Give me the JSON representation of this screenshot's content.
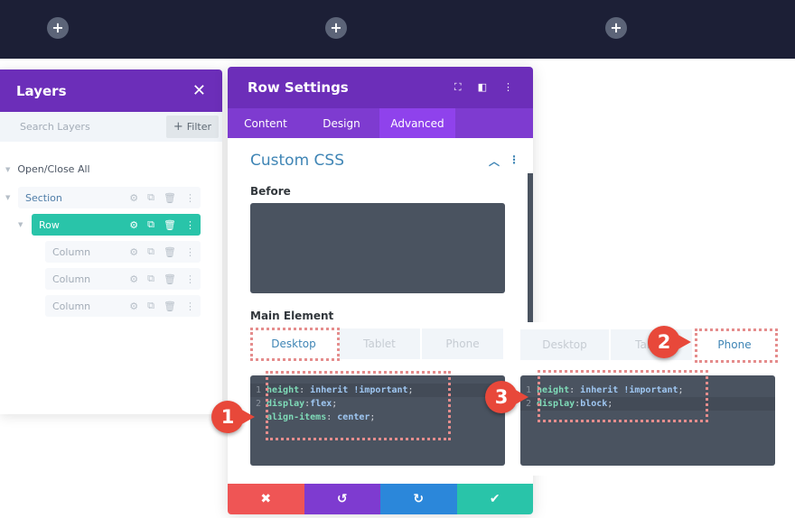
{
  "topbar": {
    "add_icons": [
      "+",
      "+",
      "+"
    ]
  },
  "layers": {
    "title": "Layers",
    "close_icon": "✕",
    "search_placeholder": "Search Layers",
    "filter_label": "Filter",
    "filter_icon": "+",
    "open_close_all": "Open/Close All",
    "items": [
      {
        "label": "Section",
        "type": "section"
      },
      {
        "label": "Row",
        "type": "row",
        "selected": true
      },
      {
        "label": "Column",
        "type": "column"
      },
      {
        "label": "Column",
        "type": "column"
      },
      {
        "label": "Column",
        "type": "column"
      }
    ],
    "item_action_icons": [
      "gear-icon",
      "duplicate-icon",
      "trash-icon",
      "more-icon"
    ]
  },
  "settings": {
    "title": "Row Settings",
    "header_icons": [
      "expand-icon",
      "split-view-icon",
      "more-icon"
    ],
    "tabs": [
      {
        "label": "Content",
        "active": false
      },
      {
        "label": "Design",
        "active": false
      },
      {
        "label": "Advanced",
        "active": true
      }
    ],
    "section_title": "Custom CSS",
    "before_label": "Before",
    "before_value": "",
    "main_element_label": "Main Element",
    "device_tabs": [
      {
        "label": "Desktop",
        "active": true
      },
      {
        "label": "Tablet",
        "active": false
      },
      {
        "label": "Phone",
        "active": false
      }
    ],
    "desktop_code": [
      {
        "n": "1",
        "prop": "height",
        "sep": ": ",
        "val": "inherit !important",
        "end": ";"
      },
      {
        "n": "2",
        "prop": "display",
        "sep": ":",
        "val": "flex",
        "end": ";"
      },
      {
        "n": "",
        "prop": "align-items",
        "sep": ": ",
        "val": "center",
        "end": ";"
      }
    ],
    "footer": {
      "cancel_icon": "✖",
      "undo_icon": "↺",
      "redo_icon": "↻",
      "save_icon": "✔",
      "colors": {
        "cancel": "#ef5555",
        "undo": "#7e3bd0",
        "redo": "#2b87da",
        "save": "#29c4a9"
      }
    }
  },
  "phone_panel": {
    "device_tabs": [
      {
        "label": "Desktop",
        "active": false
      },
      {
        "label": "Tablet",
        "active": false
      },
      {
        "label": "Phone",
        "active": true
      }
    ],
    "code": [
      {
        "n": "1",
        "prop": "height",
        "sep": ": ",
        "val": "inherit !important",
        "end": ";"
      },
      {
        "n": "2",
        "prop": "display",
        "sep": ":",
        "val": "block",
        "end": ";"
      }
    ]
  },
  "annotations": [
    {
      "number": "1"
    },
    {
      "number": "2"
    },
    {
      "number": "3"
    }
  ],
  "colors": {
    "purple": "#6c2eb9",
    "tab_purple": "#7e3bd0",
    "active_tab": "#8f42ec",
    "teal": "#29c4a9",
    "blue": "#3f85b5",
    "annotation_red": "#e8483a"
  }
}
